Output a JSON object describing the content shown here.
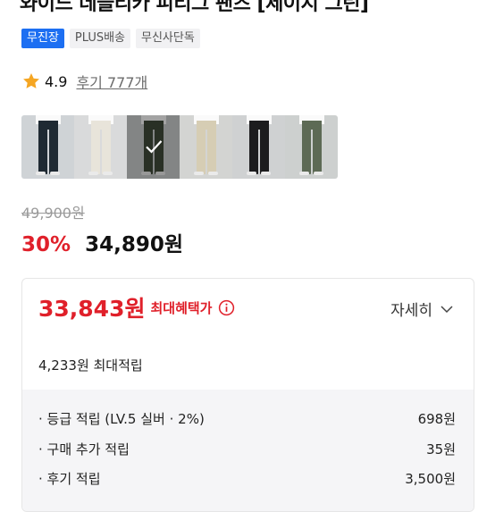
{
  "product": {
    "title": "와이드 데블리카 피티그 팬츠 [제이지 그린]",
    "badges": [
      "무진장",
      "PLUS배송",
      "무신사단독"
    ]
  },
  "rating": {
    "score": "4.9",
    "reviews": "후기 777개",
    "star_color": "#f5a623"
  },
  "variants": [
    {
      "color": "#1f2a33",
      "selected": false
    },
    {
      "color": "#e8e4da",
      "selected": false
    },
    {
      "color": "#3f4a3a",
      "selected": true
    },
    {
      "color": "#d6cdb4",
      "selected": false
    },
    {
      "color": "#1c1c1e",
      "selected": false
    },
    {
      "color": "#5d6a55",
      "selected": false
    }
  ],
  "pricing": {
    "original": "49,900원",
    "discount": "30%",
    "sale": "34,890원"
  },
  "benefit_card": {
    "max_price": "33,843원",
    "max_label": "최대혜택가",
    "detail_label": "자세히",
    "points_total": "4,233원 최대적립",
    "rows": [
      {
        "label": "· 등급 적립 (LV.5 실버 · 2%)",
        "value": "698원"
      },
      {
        "label": "· 구매 추가 적립",
        "value": "35원"
      },
      {
        "label": "· 후기 적립",
        "value": "3,500원"
      }
    ]
  },
  "colors": {
    "accent_red": "#e0202a",
    "badge_blue": "#1d6ff2"
  }
}
